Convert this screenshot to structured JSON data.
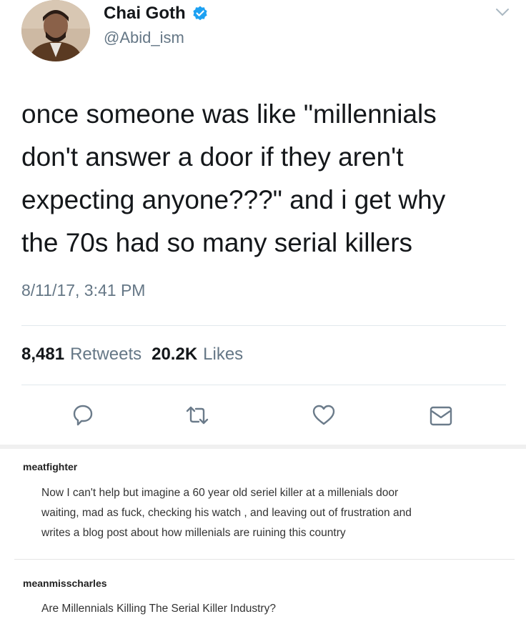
{
  "tweet": {
    "author_name": "Chai Goth",
    "author_handle": "@Abid_ism",
    "body_lines": [
      "once someone was like \"millennials",
      "don't answer a door if they aren't",
      "expecting anyone???\" and i get why",
      "the 70s had so many serial killers"
    ],
    "timestamp": "8/11/17, 3:41 PM",
    "retweets_count": "8,481",
    "retweets_label": "Retweets",
    "likes_count": "20.2K",
    "likes_label": "Likes",
    "colors": {
      "verified": "#1da1f2",
      "muted": "#657786",
      "icon": "#6b7b8a"
    },
    "icons": [
      "reply-icon",
      "retweet-icon",
      "like-icon",
      "dm-icon",
      "chevron-down-icon",
      "verified-badge-icon"
    ]
  },
  "comments": [
    {
      "username": "meatfighter",
      "lines": [
        "Now I can't help but imagine a 60 year old seriel killer at a millenials door",
        "waiting, mad as fuck, checking his watch , and leaving out of frustration and",
        "writes a blog post about how millenials are ruining this country"
      ]
    },
    {
      "username": "meanmisscharles",
      "lines": [
        "Are Millennials Killing The Serial Killer Industry?"
      ]
    }
  ]
}
